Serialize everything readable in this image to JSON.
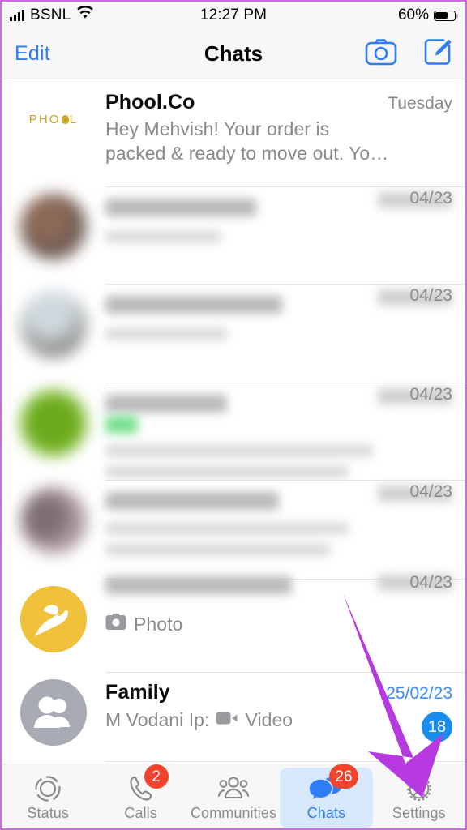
{
  "status_bar": {
    "carrier": "BSNL",
    "time": "12:27 PM",
    "battery_percent": "60%",
    "battery_level": 60,
    "signal_icon": "signal-bars-icon",
    "wifi_icon": "wifi-icon",
    "battery_icon": "battery-icon"
  },
  "nav": {
    "edit_label": "Edit",
    "title": "Chats",
    "camera_icon": "camera-icon",
    "compose_icon": "compose-icon"
  },
  "chats": [
    {
      "name": "Phool.Co",
      "time": "Tuesday",
      "unread": false,
      "preview_line1": "Hey Mehvish!  Your order is",
      "preview_line2": "packed & ready to move out.  Yo…",
      "avatar": "phool-logo-avatar",
      "blurred": false
    },
    {
      "name": "",
      "time": "04/23",
      "unread": false,
      "preview_line1": "",
      "preview_line2": "",
      "avatar": "blurred-photo-avatar",
      "blurred": true
    },
    {
      "name": "",
      "time": "04/23",
      "unread": false,
      "preview_line1": "",
      "preview_line2": "",
      "avatar": "blurred-photo-avatar",
      "blurred": true
    },
    {
      "name": "",
      "time": "04/23",
      "unread": false,
      "preview_line1": "",
      "preview_line2": "",
      "avatar": "blurred-green-avatar",
      "blurred": true
    },
    {
      "name": "",
      "time": "04/23",
      "unread": false,
      "preview_line1": "",
      "preview_line2": "",
      "avatar": "blurred-photo-avatar",
      "blurred": true
    },
    {
      "name": "",
      "time": "04/23",
      "unread": false,
      "preview_line1": "Photo",
      "preview_line2": "",
      "preview_icon": "camera-icon",
      "avatar": "yellow-hands-avatar",
      "blurred": true
    },
    {
      "name": "Family",
      "time": "25/02/23",
      "unread": true,
      "unread_count": "18",
      "preview_sender": "M Vodani Ip:",
      "preview_line1": "Video",
      "preview_icon": "video-camera-icon",
      "avatar": "group-people-avatar",
      "blurred": false
    }
  ],
  "tabs": [
    {
      "label": "Status",
      "icon": "status-rings-icon",
      "badge": "",
      "active": false
    },
    {
      "label": "Calls",
      "icon": "phone-icon",
      "badge": "2",
      "active": false
    },
    {
      "label": "Communities",
      "icon": "communities-icon",
      "badge": "",
      "active": false
    },
    {
      "label": "Chats",
      "icon": "chat-bubbles-icon",
      "badge": "26",
      "active": true
    },
    {
      "label": "Settings",
      "icon": "gear-icon",
      "badge": "",
      "active": false
    }
  ],
  "annotation": {
    "arrow_icon": "purple-arrow-annotation",
    "arrow_color": "#b63ae0",
    "points_to": "Settings"
  },
  "colors": {
    "accent_blue": "#2e7cf6",
    "badge_red": "#f4432c",
    "badge_blue": "#1a8cf0",
    "bar_background": "#f7f7f7",
    "frame_border": "#c86ee0"
  }
}
